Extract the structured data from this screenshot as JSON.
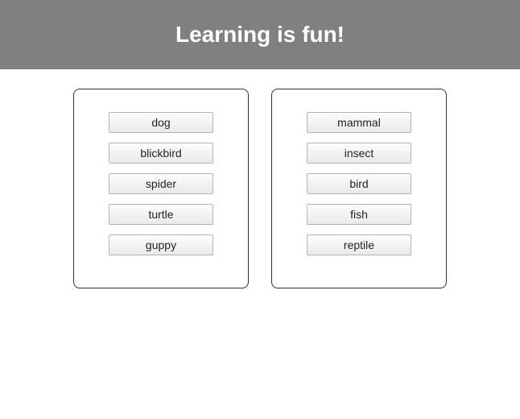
{
  "header": {
    "title": "Learning is fun!"
  },
  "left_panel": {
    "items": [
      {
        "label": "dog"
      },
      {
        "label": "blickbird"
      },
      {
        "label": "spider"
      },
      {
        "label": "turtle"
      },
      {
        "label": "guppy"
      }
    ]
  },
  "right_panel": {
    "items": [
      {
        "label": "mammal"
      },
      {
        "label": "insect"
      },
      {
        "label": "bird"
      },
      {
        "label": "fish"
      },
      {
        "label": "reptile"
      }
    ]
  }
}
